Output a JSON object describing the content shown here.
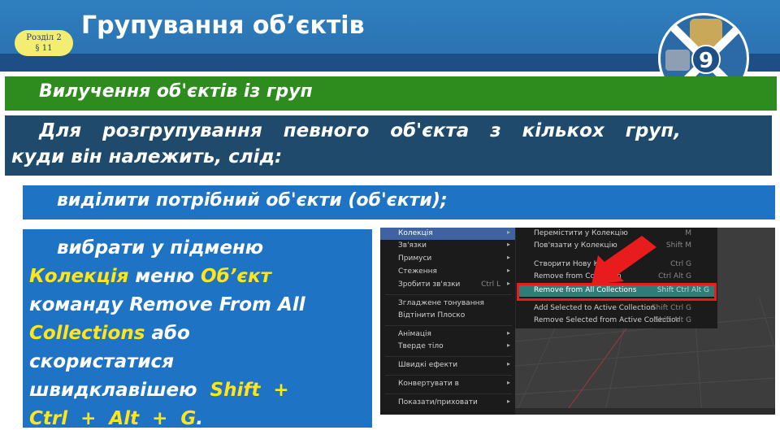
{
  "header": {
    "title": "Групування об’єктів",
    "badge_line1": "Розділ 2",
    "badge_line2": "§ 11",
    "logo_number": "9"
  },
  "section_heading": "Вилучення об'єктів із груп",
  "intro": {
    "line1": "Для розгрупування певного об'єкта з кількох груп,",
    "line2": "куди він належить, слід:"
  },
  "step1": "виділити потрібний об'єкти (об'єкти);",
  "step2": {
    "l1": "вибрати у підменю",
    "l2a": "Колекція",
    "l2b": " меню ",
    "l2c": "Об’єкт",
    "l3": "команду Remove From All",
    "l4a": "Collections",
    "l4b": " або",
    "l5": "скористатися",
    "l6a": "швидклавішею  ",
    "l6b": "Shift  +",
    "l7a": "Ctrl  +  Alt  +  G",
    "l7b": "."
  },
  "screenshot": {
    "menu": [
      {
        "label": "Колекція",
        "shortcut": "",
        "arrow": "▸"
      },
      {
        "label": "Зв'язки",
        "shortcut": "",
        "arrow": "▸"
      },
      {
        "label": "Примуси",
        "shortcut": "",
        "arrow": "▸"
      },
      {
        "label": "Стеження",
        "shortcut": "",
        "arrow": "▸"
      },
      {
        "label": "Зробити зв'язки",
        "shortcut": "Ctrl L",
        "arrow": "▸"
      },
      {
        "label": "Згладжене тонування",
        "shortcut": "",
        "arrow": ""
      },
      {
        "label": "Відтінити Плоско",
        "shortcut": "",
        "arrow": ""
      },
      {
        "label": "Анімація",
        "shortcut": "",
        "arrow": "▸"
      },
      {
        "label": "Тверде тіло",
        "shortcut": "",
        "arrow": "▸"
      },
      {
        "label": "Швидкі ефекти",
        "shortcut": "",
        "arrow": "▸"
      },
      {
        "label": "Конвертувати в",
        "shortcut": "",
        "arrow": "▸"
      },
      {
        "label": "Показати/приховати",
        "shortcut": "",
        "arrow": "▸"
      }
    ],
    "submenu": [
      {
        "label": "Перемістити у Колекцію",
        "shortcut": "M"
      },
      {
        "label": "Пов'язати у Колекцію",
        "shortcut": "Shift M"
      },
      {
        "label": "Створити Нову Колекцію",
        "shortcut": "Ctrl G"
      },
      {
        "label": "Remove from Collection",
        "shortcut": "Ctrl Alt G"
      },
      {
        "label": "Remove from All Collections",
        "shortcut": "Shift Ctrl Alt G"
      },
      {
        "label": "Add Selected to Active Collection",
        "shortcut": "Shift Ctrl G"
      },
      {
        "label": "Remove Selected from Active Collection",
        "shortcut": "Shift Alt G"
      }
    ]
  },
  "colors": {
    "header": "#2f7fbf",
    "green": "#2e8b1e",
    "navy": "#1f4a6b",
    "blue": "#1f73c4",
    "highlight_yellow": "#ffe51a",
    "red": "#e81c1c"
  }
}
